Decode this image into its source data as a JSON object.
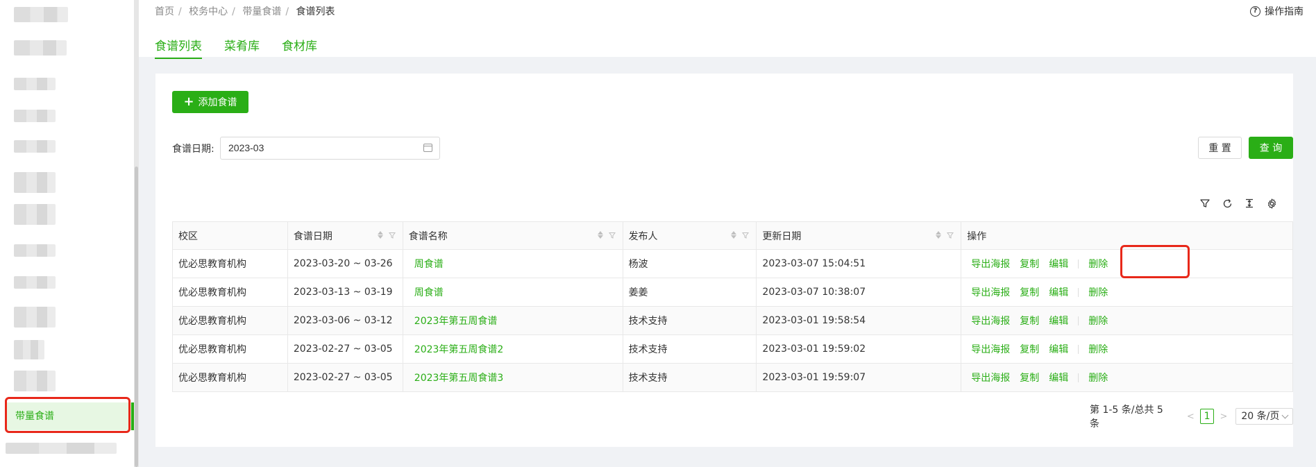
{
  "breadcrumb": {
    "items": [
      "首页",
      "校务中心",
      "带量食谱"
    ],
    "current": "食谱列表"
  },
  "guide_label": "操作指南",
  "tabs": [
    {
      "label": "食谱列表"
    },
    {
      "label": "菜肴库"
    },
    {
      "label": "食材库"
    }
  ],
  "sidebar": {
    "active_label": "带量食谱"
  },
  "toolbar": {
    "add_label": "添加食谱"
  },
  "filter": {
    "label": "食谱日期:",
    "date_value": "2023-03",
    "reset_label": "重 置",
    "query_label": "查 询"
  },
  "table": {
    "headers": [
      "校区",
      "食谱日期",
      "食谱名称",
      "发布人",
      "更新日期",
      "操作"
    ],
    "rows": [
      {
        "campus": "优必思教育机构",
        "date": "2023-03-20 ~ 03-26",
        "name": "周食谱",
        "publisher": "杨波",
        "updated": "2023-03-07 15:04:51"
      },
      {
        "campus": "优必思教育机构",
        "date": "2023-03-13 ~ 03-19",
        "name": "周食谱",
        "publisher": "姜姜",
        "updated": "2023-03-07 10:38:07"
      },
      {
        "campus": "优必思教育机构",
        "date": "2023-03-06 ~ 03-12",
        "name": "2023年第五周食谱",
        "publisher": "技术支持",
        "updated": "2023-03-01 19:58:54"
      },
      {
        "campus": "优必思教育机构",
        "date": "2023-02-27 ~ 03-05",
        "name": "2023年第五周食谱2",
        "publisher": "技术支持",
        "updated": "2023-03-01 19:59:02"
      },
      {
        "campus": "优必思教育机构",
        "date": "2023-02-27 ~ 03-05",
        "name": "2023年第五周食谱3",
        "publisher": "技术支持",
        "updated": "2023-03-01 19:59:07"
      }
    ],
    "actions": {
      "export": "导出海报",
      "copy": "复制",
      "edit": "编辑",
      "delete": "删除"
    }
  },
  "pagination": {
    "summary": "第 1-5 条/总共 5 条",
    "current_page": "1",
    "page_size": "20 条/页"
  },
  "colors": {
    "accent": "#2aae16",
    "highlight": "#e8281a"
  }
}
